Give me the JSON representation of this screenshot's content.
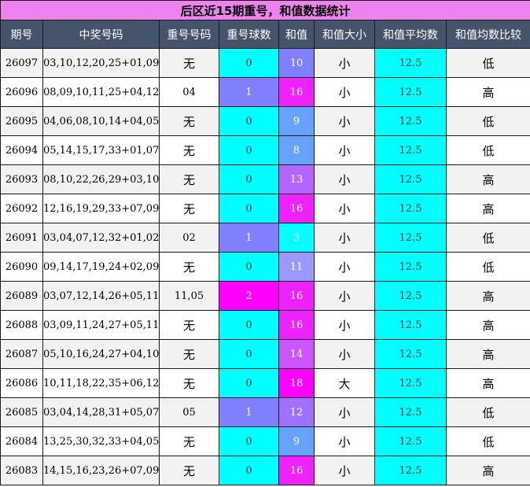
{
  "title": "后区近15期重号，和值数据统计",
  "headers": [
    "期号",
    "中奖号码",
    "重号号码",
    "重号球数",
    "和值",
    "和值大小",
    "和值平均数",
    "和值均数比较"
  ],
  "colors": {
    "title_bg": "#ee82ee",
    "header_bg": "#44546a",
    "cyan": "#00ffff",
    "repeat1": "#8080ff",
    "repeat2": "#ff00ff",
    "sum_colors": {
      "3": "#00ffff",
      "8": "#66a3ff",
      "9": "#66a3ff",
      "10": "#7f7fff",
      "11": "#9999ff",
      "12": "#a070ff",
      "13": "#b366ff",
      "14": "#cc55ff",
      "16": "#ee22ff",
      "18": "#ff00ff"
    }
  },
  "rows": [
    {
      "issue": "26097",
      "numbers": "03,10,12,20,25+01,09",
      "repeat": "无",
      "count": "0",
      "sum": "10",
      "size": "小",
      "avg": "12.5",
      "cmp": "低"
    },
    {
      "issue": "26096",
      "numbers": "08,09,10,11,25+04,12",
      "repeat": "04",
      "count": "1",
      "sum": "16",
      "size": "小",
      "avg": "12.5",
      "cmp": "高"
    },
    {
      "issue": "26095",
      "numbers": "04,06,08,10,14+04,05",
      "repeat": "无",
      "count": "0",
      "sum": "9",
      "size": "小",
      "avg": "12.5",
      "cmp": "低"
    },
    {
      "issue": "26094",
      "numbers": "05,14,15,17,33+01,07",
      "repeat": "无",
      "count": "0",
      "sum": "8",
      "size": "小",
      "avg": "12.5",
      "cmp": "低"
    },
    {
      "issue": "26093",
      "numbers": "08,10,22,26,29+03,10",
      "repeat": "无",
      "count": "0",
      "sum": "13",
      "size": "小",
      "avg": "12.5",
      "cmp": "高"
    },
    {
      "issue": "26092",
      "numbers": "12,16,19,29,33+07,09",
      "repeat": "无",
      "count": "0",
      "sum": "16",
      "size": "小",
      "avg": "12.5",
      "cmp": "高"
    },
    {
      "issue": "26091",
      "numbers": "03,04,07,12,32+01,02",
      "repeat": "02",
      "count": "1",
      "sum": "3",
      "size": "小",
      "avg": "12.5",
      "cmp": "低"
    },
    {
      "issue": "26090",
      "numbers": "09,14,17,19,24+02,09",
      "repeat": "无",
      "count": "0",
      "sum": "11",
      "size": "小",
      "avg": "12.5",
      "cmp": "低"
    },
    {
      "issue": "26089",
      "numbers": "03,07,12,14,26+05,11",
      "repeat": "11,05",
      "count": "2",
      "sum": "16",
      "size": "小",
      "avg": "12.5",
      "cmp": "高"
    },
    {
      "issue": "26088",
      "numbers": "03,09,11,24,27+05,11",
      "repeat": "无",
      "count": "0",
      "sum": "16",
      "size": "小",
      "avg": "12.5",
      "cmp": "高"
    },
    {
      "issue": "26087",
      "numbers": "05,10,16,24,27+04,10",
      "repeat": "无",
      "count": "0",
      "sum": "14",
      "size": "小",
      "avg": "12.5",
      "cmp": "高"
    },
    {
      "issue": "26086",
      "numbers": "10,11,18,22,35+06,12",
      "repeat": "无",
      "count": "0",
      "sum": "18",
      "size": "大",
      "avg": "12.5",
      "cmp": "高"
    },
    {
      "issue": "26085",
      "numbers": "03,04,14,28,31+05,07",
      "repeat": "05",
      "count": "1",
      "sum": "12",
      "size": "小",
      "avg": "12.5",
      "cmp": "低"
    },
    {
      "issue": "26084",
      "numbers": "13,25,30,32,33+04,05",
      "repeat": "无",
      "count": "0",
      "sum": "9",
      "size": "小",
      "avg": "12.5",
      "cmp": "低"
    },
    {
      "issue": "26083",
      "numbers": "14,15,16,23,26+07,09",
      "repeat": "无",
      "count": "0",
      "sum": "16",
      "size": "小",
      "avg": "12.5",
      "cmp": "高"
    }
  ]
}
